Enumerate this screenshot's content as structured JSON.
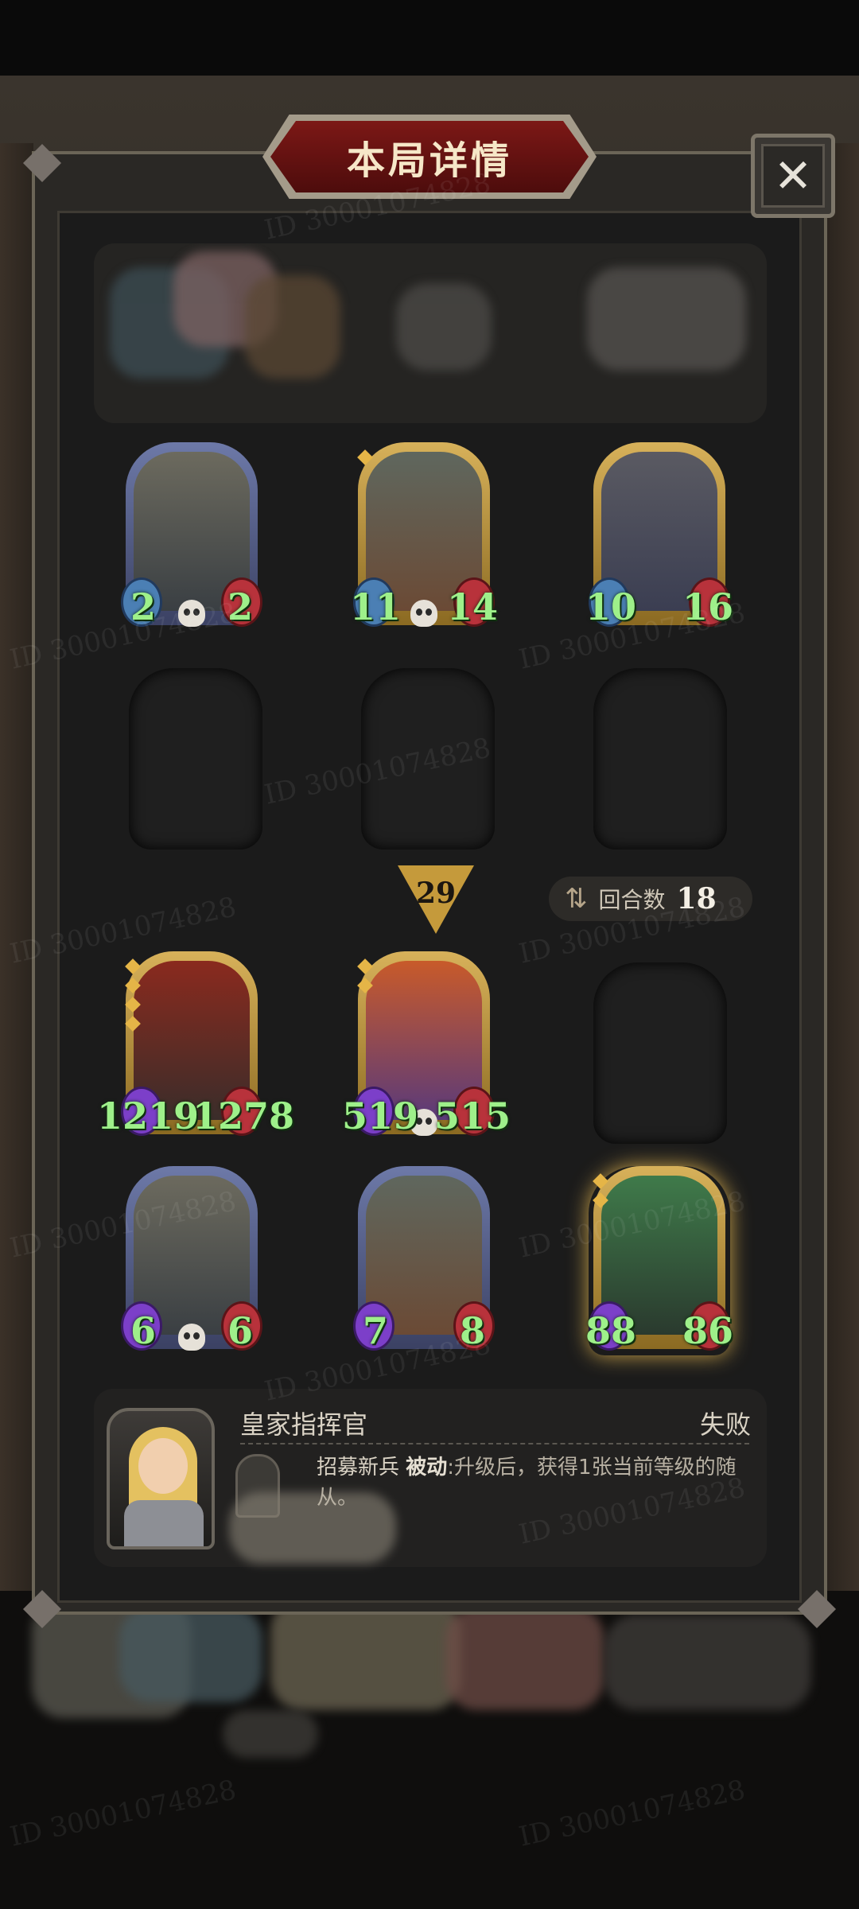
{
  "dialog": {
    "title": "本局详情",
    "close_icon": "close-icon"
  },
  "opponent_board": {
    "redacted": true
  },
  "top_row": [
    {
      "name": "bell-robot",
      "attack": "2",
      "health": "2",
      "frame": "steel",
      "stars": 0
    },
    {
      "name": "bomb-cart",
      "attack": "11",
      "health": "14",
      "frame": "gold",
      "stars": 1
    },
    {
      "name": "rat-bandit",
      "attack": "10",
      "health": "16",
      "frame": "gold",
      "stars": 0
    }
  ],
  "level_badge": "29",
  "round": {
    "label": "回合数",
    "value": "18"
  },
  "bottom_row_1": [
    {
      "name": "hooded-assassin",
      "attack": "1219",
      "health": "1278",
      "frame": "gold",
      "stars": 4
    },
    {
      "name": "flame-demon",
      "attack": "519",
      "health": "515",
      "frame": "gold",
      "stars": 2
    }
  ],
  "bottom_row_2": [
    {
      "name": "bell-robot",
      "attack": "6",
      "health": "6",
      "frame": "steel",
      "stars": 0
    },
    {
      "name": "bomb-cart",
      "attack": "7",
      "health": "8",
      "frame": "steel",
      "stars": 0
    },
    {
      "name": "cursed-sword",
      "attack": "88",
      "health": "86",
      "frame": "gold",
      "stars": 2
    }
  ],
  "hero": {
    "name": "皇家指挥官",
    "result": "失败",
    "skill_name": "招募新兵",
    "skill_tag": "被动",
    "skill_desc": ":升级后，获得1张当前等级的随从。"
  },
  "watermark": "ID 30001074828",
  "colors": {
    "stat_green": "#9ef08a",
    "gold_frame": "#d7b15a",
    "steel_frame": "#6d79a8",
    "title_red": "#7c1816"
  }
}
